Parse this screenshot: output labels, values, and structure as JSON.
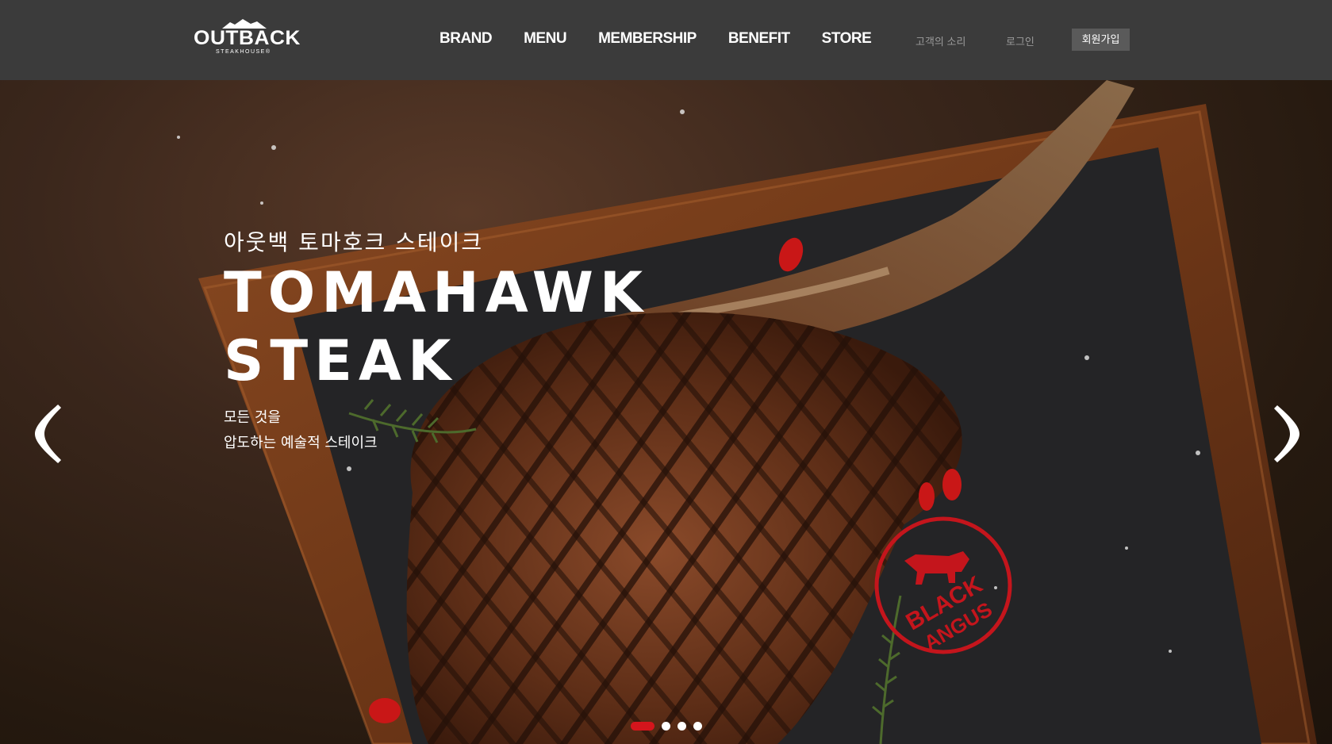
{
  "brand": {
    "logo_text": "OUTBACK",
    "logo_sub": "STEAKHOUSE®"
  },
  "nav": {
    "items": [
      {
        "label": "BRAND"
      },
      {
        "label": "MENU"
      },
      {
        "label": "MEMBERSHIP"
      },
      {
        "label": "BENEFIT"
      },
      {
        "label": "STORE"
      }
    ],
    "customer_voice": "고객의 소리",
    "login": "로그인",
    "join": "회원가입"
  },
  "hero": {
    "kr_title": "아웃백 토마호크 스테이크",
    "en_title_line1": "TOMAHAWK",
    "en_title_line2": "STEAK",
    "sub_line1": "모든 것을",
    "sub_line2": "압도하는 예술적 스테이크",
    "badge_text_1": "BLACK",
    "badge_text_2": "ANGUS",
    "slide_count": 4,
    "active_slide": 1
  },
  "colors": {
    "header_bg": "#3b3b3b",
    "accent_red": "#d4151c",
    "join_bg": "#5a5a5a"
  }
}
